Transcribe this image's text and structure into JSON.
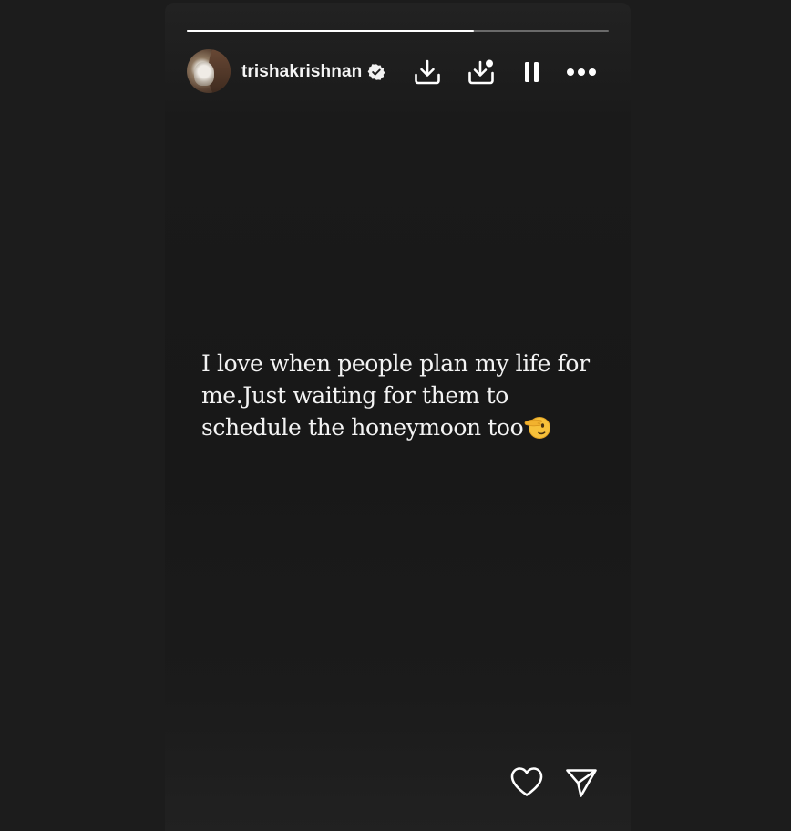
{
  "story": {
    "progress": 0.68,
    "username": "trishakrishnan",
    "verified": true,
    "text_line1": "I love when people plan my life for",
    "text_line2": "me.Just waiting for them to",
    "text_line3": "schedule the honeymoon too"
  },
  "icons": {
    "download": "download-icon",
    "save": "save-to-collection-icon",
    "pause": "pause-icon",
    "more": "more-options-icon",
    "like": "heart-icon",
    "share": "send-icon",
    "emoji": "saluting-face-emoji"
  },
  "colors": {
    "background": "#1c1c1c",
    "card": "#1a1a1a",
    "text": "#f3f3f3",
    "progress_fill": "#ffffff",
    "progress_track": "#6a6a6a"
  }
}
